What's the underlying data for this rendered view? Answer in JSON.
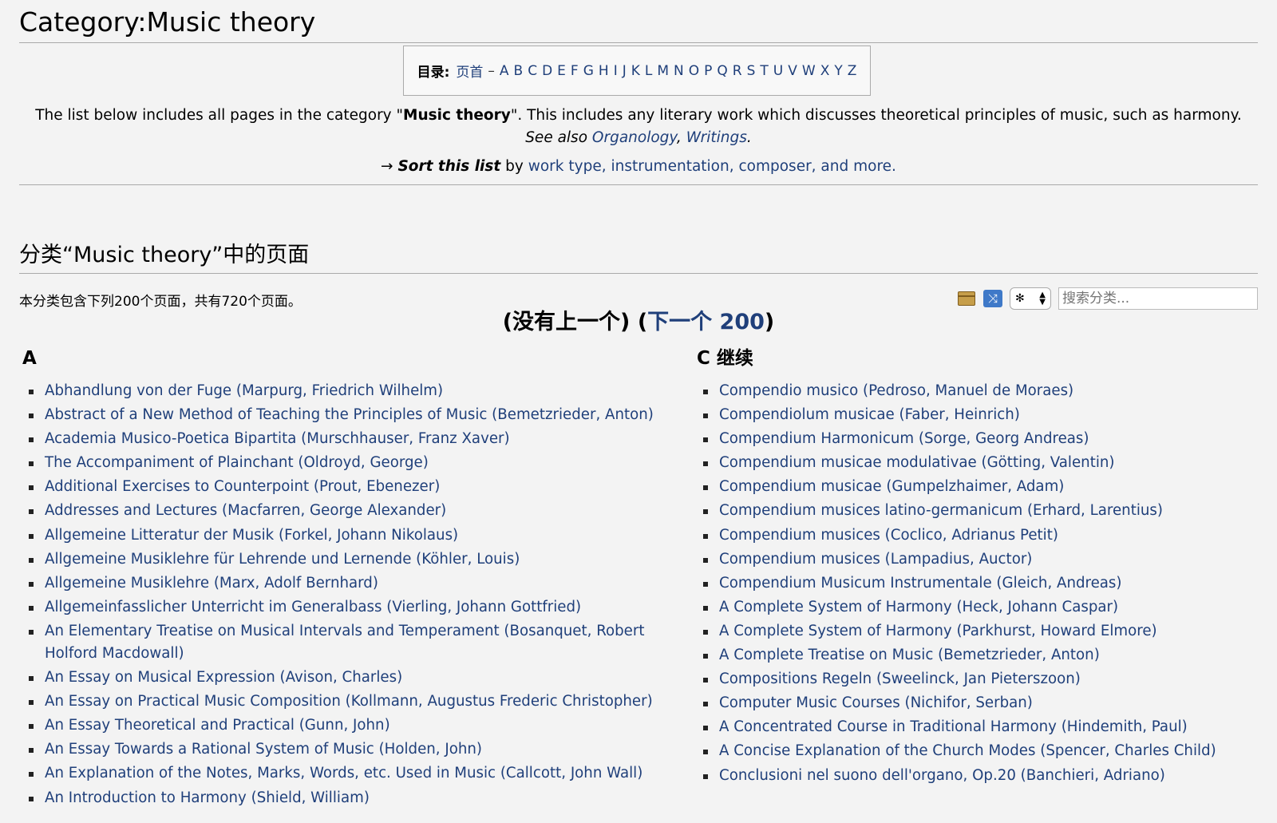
{
  "page": {
    "title": "Category:Music theory"
  },
  "toc": {
    "label": "目录:",
    "home": "页首",
    "dash": "–",
    "letters": [
      "A",
      "B",
      "C",
      "D",
      "E",
      "F",
      "G",
      "H",
      "I",
      "J",
      "K",
      "L",
      "M",
      "N",
      "O",
      "P",
      "Q",
      "R",
      "S",
      "T",
      "U",
      "V",
      "W",
      "X",
      "Y",
      "Z"
    ]
  },
  "description": {
    "part1": "The list below includes all pages in the category \"",
    "bold": "Music theory",
    "part2": "\". This includes any literary work which discusses theoretical principles of music, such as harmony.",
    "see_also": "See also",
    "link1": "Organology",
    "comma": ",",
    "link2": "Writings",
    "period": "."
  },
  "sort": {
    "arrow": "→",
    "bold_italic": "Sort this list",
    "by": "by",
    "link": "work type, instrumentation, composer, and more."
  },
  "section": {
    "heading": "分类“Music theory”中的页面",
    "count_text": "本分类包含下列200个页面，共有720个页面。",
    "search_placeholder": "搜索分类...",
    "select_value": "✻"
  },
  "pager": {
    "prev": "(没有上一个)",
    "next_open": "(",
    "next_link": "下一个 200",
    "next_close": ")"
  },
  "columns": {
    "left": {
      "heading": "A",
      "items": [
        "Abhandlung von der Fuge (Marpurg, Friedrich Wilhelm)",
        "Abstract of a New Method of Teaching the Principles of Music (Bemetzrieder, Anton)",
        "Academia Musico-Poetica Bipartita (Murschhauser, Franz Xaver)",
        "The Accompaniment of Plainchant (Oldroyd, George)",
        "Additional Exercises to Counterpoint (Prout, Ebenezer)",
        "Addresses and Lectures (Macfarren, George Alexander)",
        "Allgemeine Litteratur der Musik (Forkel, Johann Nikolaus)",
        "Allgemeine Musiklehre für Lehrende und Lernende (Köhler, Louis)",
        "Allgemeine Musiklehre (Marx, Adolf Bernhard)",
        "Allgemeinfasslicher Unterricht im Generalbass (Vierling, Johann Gottfried)",
        "An Elementary Treatise on Musical Intervals and Temperament (Bosanquet, Robert Holford Macdowall)",
        "An Essay on Musical Expression (Avison, Charles)",
        "An Essay on Practical Music Composition (Kollmann, Augustus Frederic Christopher)",
        "An Essay Theoretical and Practical (Gunn, John)",
        "An Essay Towards a Rational System of Music (Holden, John)",
        "An Explanation of the Notes, Marks, Words, etc. Used in Music (Callcott, John Wall)",
        "An Introduction to Harmony (Shield, William)"
      ]
    },
    "right": {
      "heading": "C 继续",
      "items": [
        "Compendio musico (Pedroso, Manuel de Moraes)",
        "Compendiolum musicae (Faber, Heinrich)",
        "Compendium Harmonicum (Sorge, Georg Andreas)",
        "Compendium musicae modulativae (Götting, Valentin)",
        "Compendium musicae (Gumpelzhaimer, Adam)",
        "Compendium musices latino-germanicum (Erhard, Larentius)",
        "Compendium musices (Coclico, Adrianus Petit)",
        "Compendium musices (Lampadius, Auctor)",
        "Compendium Musicum Instrumentale (Gleich, Andreas)",
        "A Complete System of Harmony (Heck, Johann Caspar)",
        "A Complete System of Harmony (Parkhurst, Howard Elmore)",
        "A Complete Treatise on Music (Bemetzrieder, Anton)",
        "Compositions Regeln (Sweelinck, Jan Pieterszoon)",
        "Computer Music Courses (Nichifor, Serban)",
        "A Concentrated Course in Traditional Harmony (Hindemith, Paul)",
        "A Concise Explanation of the Church Modes (Spencer, Charles Child)",
        "Conclusioni nel suono dell'organo, Op.20 (Banchieri, Adriano)"
      ]
    }
  }
}
